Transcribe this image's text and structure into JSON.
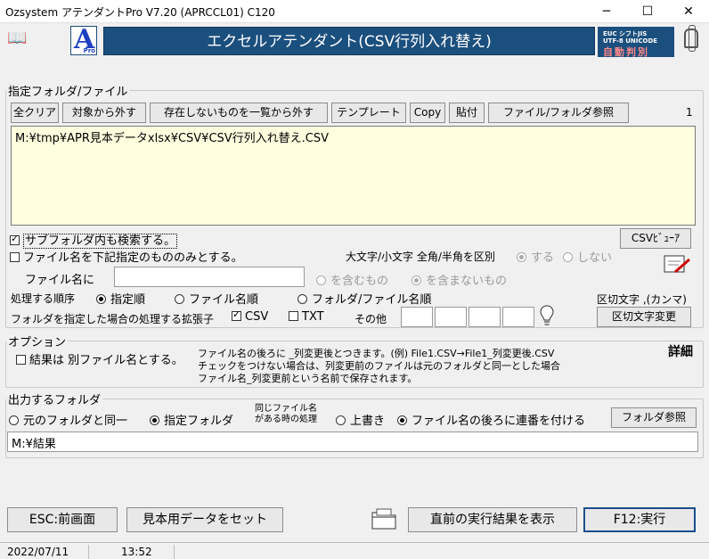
{
  "window": {
    "title": "Ozsystem アテンダントPro V7.20 (APRCCL01)  C120"
  },
  "header": {
    "banner": "エクセルアテンダント(CSV行列入れ替え)",
    "logo_letter": "A",
    "logo_sub": "Pro",
    "enc_line1": "EUC   シフトJIS",
    "enc_line2": "UTF-8  UNICODE",
    "enc_line3": "自動判別"
  },
  "file_section": {
    "legend": "指定フォルダ/ファイル",
    "buttons": {
      "clear_all": "全クリア",
      "remove_selected": "対象から外す",
      "remove_missing": "存在しないものを一覧から外す",
      "template": "テンプレート",
      "copy": "Copy",
      "paste": "貼付",
      "browse": "ファイル/フォルダ参照"
    },
    "count": "1",
    "file_list": "M:¥tmp¥APR見本データxlsx¥CSV¥CSV行列入れ替え.CSV",
    "search_subfolders": "サブフォルダ内も検索する。",
    "filter_label": "ファイル名を下記指定のもののみとする。",
    "csv_viewer": "CSVﾋﾞｭｰｱ",
    "case_label": "大文字/小文字 全角/半角を区別",
    "case_yes": "する",
    "case_no": "しない",
    "filename_label": "ファイル名に",
    "filename_value": "",
    "contains": "を含むもの",
    "not_contains": "を含まないもの",
    "order_label": "処理する順序",
    "order_specified": "指定順",
    "order_filename": "ファイル名順",
    "order_folder_filename": "フォルダ/ファイル名順",
    "delimiter_label": "区切文字 ,(カンマ)",
    "ext_label": "フォルダを指定した場合の処理する拡張子",
    "ext_csv": "CSV",
    "ext_txt": "TXT",
    "ext_other": "その他",
    "delimiter_change": "区切文字変更"
  },
  "options": {
    "legend": "オプション",
    "separate_file": "結果は 別ファイル名とする。",
    "note1": "ファイル名の後ろに _列変更後とつきます。(例) File1.CSV→File1_列変更後.CSV",
    "note2": "チェックをつけない場合は、列変更前のファイルは元のフォルダと同一とした場合",
    "note3": "ファイル名_列変更前という名前で保存されます。",
    "details": "詳細"
  },
  "output": {
    "legend": "出力するフォルダ",
    "same_folder": "元のフォルダと同一",
    "specified_folder": "指定フォルダ",
    "same_name_line1": "同じファイル名",
    "same_name_line2": "がある時の処理",
    "overwrite": "上書き",
    "append_number": "ファイル名の後ろに連番を付ける",
    "folder_browse": "フォルダ参照",
    "path": "M:¥結果"
  },
  "footer": {
    "esc": "ESC:前画面",
    "sample_data": "見本用データをセット",
    "show_last_result": "直前の実行結果を表示",
    "execute": "F12:実行"
  },
  "status": {
    "date": "2022/07/11",
    "time": "13:52"
  }
}
